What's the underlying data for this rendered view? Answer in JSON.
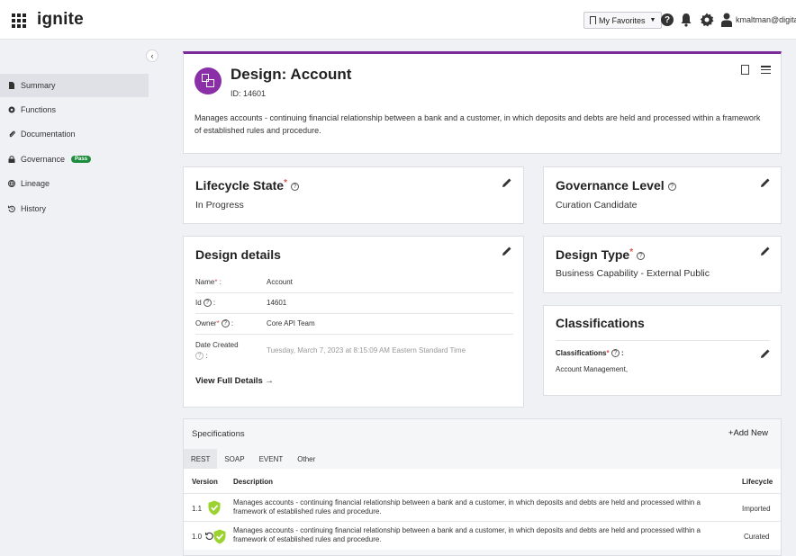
{
  "app": {
    "name": "ignite",
    "favorites_label": "My Favorites",
    "user": "kmaltman@digita"
  },
  "sidebar": {
    "items": [
      {
        "label": "Summary",
        "icon": "document-icon"
      },
      {
        "label": "Functions",
        "icon": "gear-icon"
      },
      {
        "label": "Documentation",
        "icon": "paperclip-icon"
      },
      {
        "label": "Governance",
        "icon": "lock-icon",
        "badge": "Pass"
      },
      {
        "label": "Lineage",
        "icon": "globe-icon"
      },
      {
        "label": "History",
        "icon": "history-icon"
      }
    ]
  },
  "header": {
    "title": "Design: Account",
    "id_label": "ID: 14601",
    "description": "Manages accounts - continuing financial relationship between a bank and a customer, in which deposits and debts are held and processed within a framework of established rules and procedure."
  },
  "lifecycle": {
    "title": "Lifecycle State",
    "required": "*",
    "value": "In Progress"
  },
  "governance": {
    "title": "Governance Level",
    "value": "Curation Candidate"
  },
  "design_details": {
    "title": "Design details",
    "rows": [
      {
        "key": "Name",
        "req": "*",
        "suffix": " :",
        "value": "Account"
      },
      {
        "key": "Id",
        "req": "",
        "suffix": " :",
        "value": "14601"
      },
      {
        "key": "Owner",
        "req": "*",
        "suffix": " :",
        "value": "Core API Team"
      },
      {
        "key": "Date Created",
        "req": "",
        "suffix": " :",
        "value": "Tuesday, March 7, 2023 at 8:15:09 AM Eastern Standard Time"
      }
    ],
    "view_full": "View Full Details →"
  },
  "design_type": {
    "title": "Design Type",
    "required": "*",
    "value": "Business Capability - External Public"
  },
  "classifications": {
    "title": "Classifications",
    "field_label": "Classifications",
    "required": "*",
    "value": "Account Management,"
  },
  "specifications": {
    "title": "Specifications",
    "add_new": "+Add New",
    "tabs": [
      "REST",
      "SOAP",
      "EVENT",
      "Other"
    ],
    "active_tab": "REST",
    "columns": [
      "Version",
      "Description",
      "Lifecycle"
    ],
    "rows": [
      {
        "version": "1.1",
        "description": "Manages accounts - continuing financial relationship between a bank and a customer, in which deposits and debts are held and processed within a framework of established rules and procedure.",
        "lifecycle": "Imported"
      },
      {
        "version": "1.0",
        "description": "Manages accounts - continuing financial relationship between a bank and a customer, in which deposits and debts are held and processed within a framework of established rules and procedure.",
        "lifecycle": "Curated"
      }
    ]
  },
  "colors": {
    "accent": "#7b2a9a",
    "badge_purple": "#8a2fa8",
    "pass_green": "#1e8e3e",
    "shield_green": "#9bd22e",
    "required_red": "#d9534f"
  }
}
